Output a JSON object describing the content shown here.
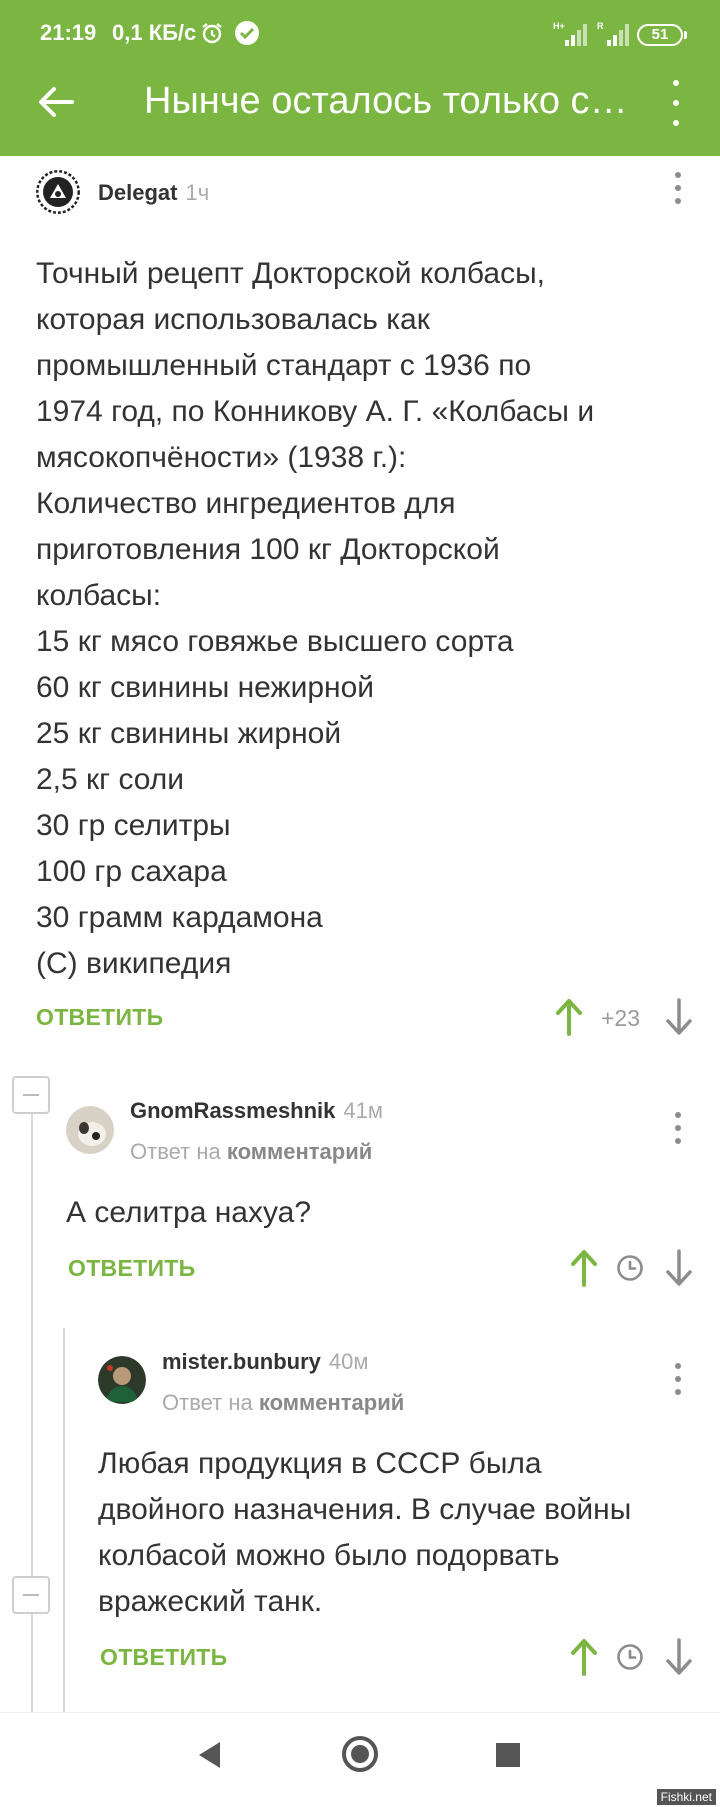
{
  "status_bar": {
    "time": "21:19",
    "speed": "0,1 КБ/с",
    "battery": "51"
  },
  "app_bar": {
    "title": "Нынче осталось только свинина"
  },
  "comments": [
    {
      "author": "Delegat",
      "time": "1ч",
      "text_lines": [
        "Точный рецепт Докторской колбасы,",
        "которая использовалась как",
        "промышленный стандарт с 1936 по",
        "1974 год, по Конникову А. Г. «Колбасы и",
        "мясокопчёности» (1938 г.):",
        "Количество ингредиентов для",
        "приготовления 100 кг Докторской",
        "колбасы:",
        "15 кг мясо говяжье высшего сорта",
        "60 кг свинины нежирной",
        "25 кг свинины жирной",
        "2,5 кг соли",
        "30 гр селитры",
        "100 гр сахара",
        "30 грамм кардамона",
        " (С) википедия"
      ],
      "reply_label": "ОТВЕТИТЬ",
      "rating": "+23"
    },
    {
      "author": "GnomRassmeshnik",
      "time": "41м",
      "reply_prefix": "Ответ на",
      "reply_target": "комментарий",
      "text_lines": [
        "А селитра нахуа?"
      ],
      "reply_label": "ОТВЕТИТЬ"
    },
    {
      "author": "mister.bunbury",
      "time": "40м",
      "reply_prefix": "Ответ на",
      "reply_target": "комментарий",
      "text_lines": [
        "Любая продукция в СССР была",
        "двойного назначения. В случае войны",
        "колбасой можно было подорвать",
        "вражеский танк."
      ],
      "reply_label": "ОТВЕТИТЬ"
    }
  ],
  "watermark": "Fishki.net",
  "colors": {
    "accent": "#7cb642",
    "muted": "#aaaaaa",
    "text": "#333333"
  },
  "icons": [
    "back-arrow-icon",
    "more-vert-icon",
    "upvote-arrow-icon",
    "downvote-arrow-icon",
    "clock-icon",
    "collapse-icon",
    "nav-back-icon",
    "nav-home-icon",
    "nav-recent-icon"
  ]
}
